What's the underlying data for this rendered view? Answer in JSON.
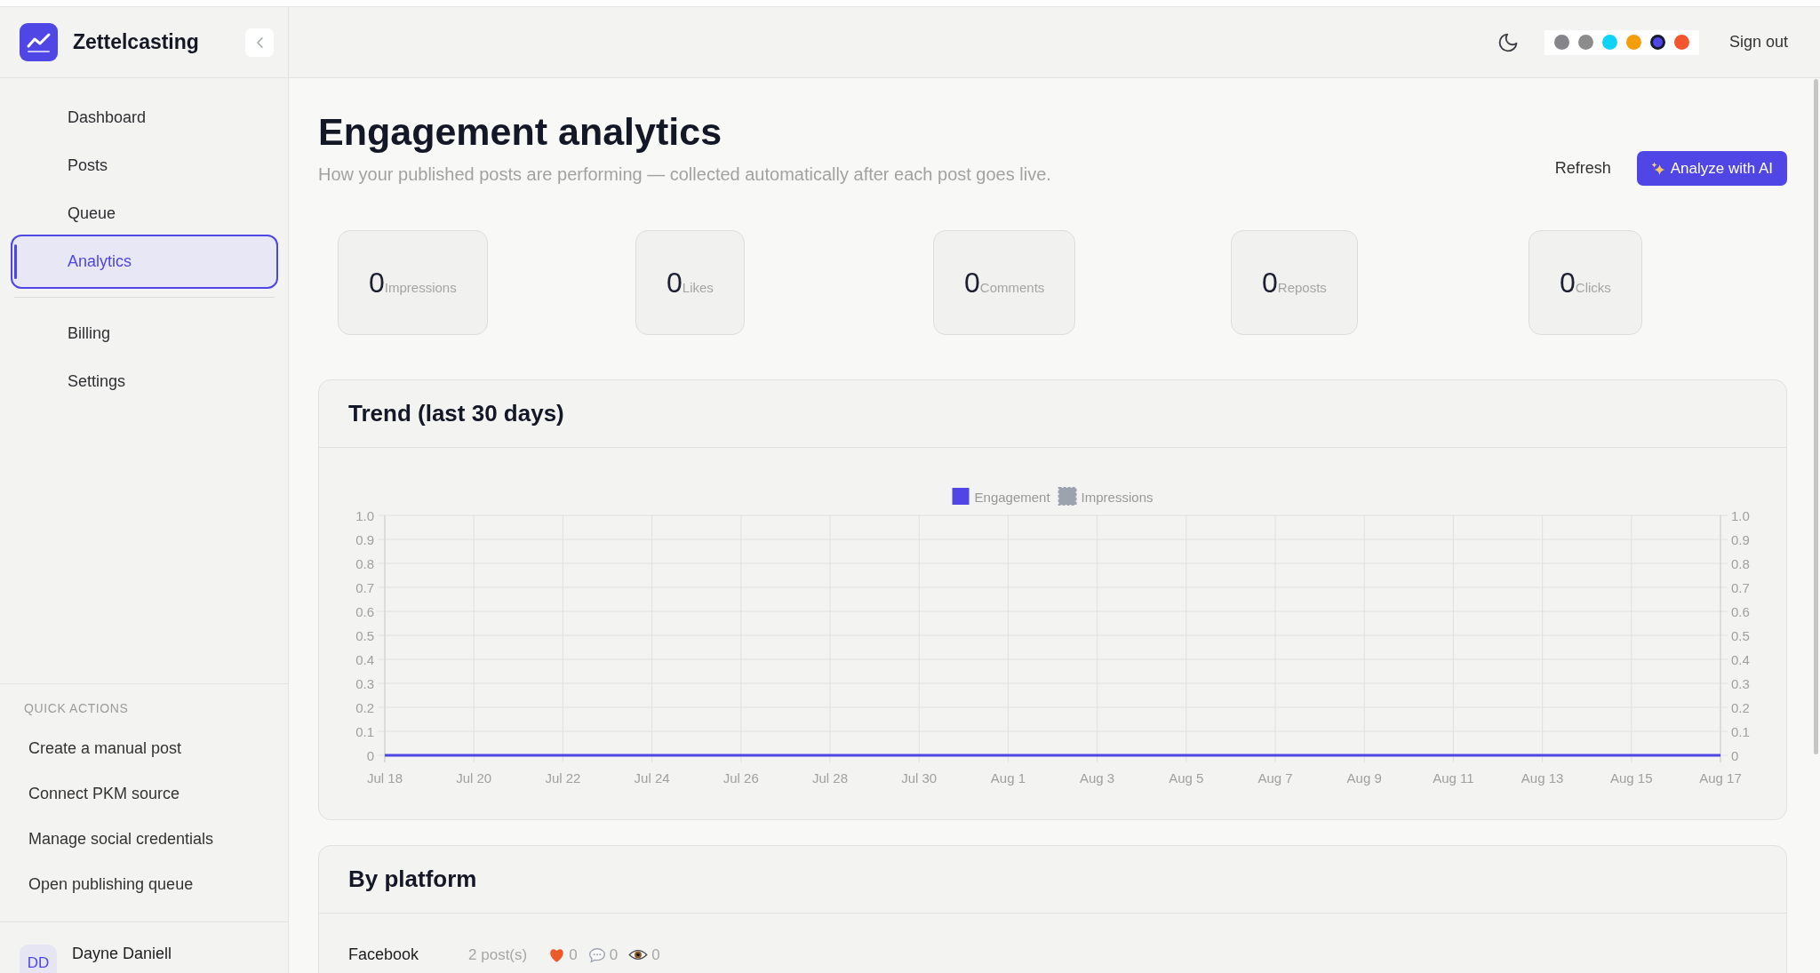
{
  "app": {
    "name": "Zettelcasting"
  },
  "sidebar": {
    "nav_groups": [
      {
        "items": [
          {
            "label": "Dashboard",
            "selected": false
          },
          {
            "label": "Posts",
            "selected": false
          },
          {
            "label": "Queue",
            "selected": false
          },
          {
            "label": "Analytics",
            "selected": true
          }
        ]
      },
      {
        "items": [
          {
            "label": "Billing",
            "selected": false
          },
          {
            "label": "Settings",
            "selected": false
          }
        ]
      }
    ],
    "quick_actions": {
      "heading": "QUICK ACTIONS",
      "items": [
        "Create a manual post",
        "Connect PKM source",
        "Manage social credentials",
        "Open publishing queue"
      ]
    },
    "user": {
      "initials": "DD",
      "name": "Dayne Daniell"
    }
  },
  "header": {
    "theme_colors": [
      {
        "color": "#84848a",
        "selected": false
      },
      {
        "color": "#8c8c8c",
        "selected": false
      },
      {
        "color": "#0ed2f7",
        "selected": false
      },
      {
        "color": "#f59e0b",
        "selected": false
      },
      {
        "color": "#4f46e5",
        "selected": true
      },
      {
        "color": "#f4552f",
        "selected": false
      }
    ],
    "sign_out": "Sign out"
  },
  "page": {
    "title": "Engagement analytics",
    "subtitle": "How your published posts are performing — collected automatically after each post goes live.",
    "actions": [
      {
        "label": "Refresh",
        "kind": "plain"
      },
      {
        "label": "Analyze with AI",
        "kind": "primary"
      }
    ]
  },
  "stats": [
    {
      "value": "0",
      "label": "Impressions"
    },
    {
      "value": "0",
      "label": "Likes"
    },
    {
      "value": "0",
      "label": "Comments"
    },
    {
      "value": "0",
      "label": "Reposts"
    },
    {
      "value": "0",
      "label": "Clicks"
    }
  ],
  "trend": {
    "title": "Trend (last 30 days)",
    "chart_data": {
      "type": "line",
      "categories": [
        "Jul 18",
        "Jul 20",
        "Jul 22",
        "Jul 24",
        "Jul 26",
        "Jul 28",
        "Jul 30",
        "Aug 1",
        "Aug 3",
        "Aug 5",
        "Aug 7",
        "Aug 9",
        "Aug 11",
        "Aug 13",
        "Aug 15",
        "Aug 17"
      ],
      "series": [
        {
          "name": "Engagement",
          "color": "#4f46e5",
          "line_style": "solid",
          "values": [
            0,
            0,
            0,
            0,
            0,
            0,
            0,
            0,
            0,
            0,
            0,
            0,
            0,
            0,
            0,
            0
          ]
        },
        {
          "name": "Impressions",
          "color": "#9ca3af",
          "line_style": "dashed",
          "values": [
            null,
            null,
            null,
            null,
            null,
            null,
            null,
            null,
            null,
            null,
            null,
            null,
            null,
            null,
            null,
            null
          ]
        }
      ],
      "ylim": [
        0,
        1
      ],
      "yticks": [
        0,
        0.1,
        0.2,
        0.3,
        0.4,
        0.5,
        0.6,
        0.7,
        0.8,
        0.9,
        {
          "value": 1,
          "label": "1.0"
        }
      ],
      "y2lim": [
        0,
        1
      ],
      "y2ticks": [
        0,
        0.1,
        0.2,
        0.3,
        0.4,
        0.5,
        0.6,
        0.7,
        0.8,
        0.9,
        {
          "value": 1,
          "label": "1.0"
        }
      ],
      "grid": true,
      "legend": true
    }
  },
  "by_platform": {
    "title": "By platform",
    "rows": [
      {
        "platform": "Facebook",
        "posts": "2 post(s)",
        "likes": "0",
        "comments": "0",
        "views": "0"
      }
    ]
  }
}
